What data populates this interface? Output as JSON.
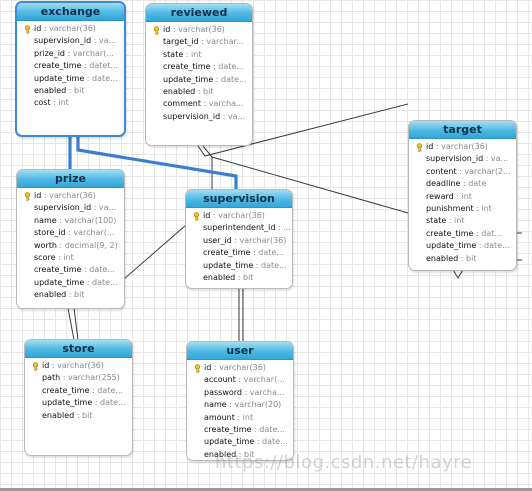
{
  "tables": [
    {
      "key": "exchange",
      "name": "exchange",
      "selected": true,
      "columns": [
        {
          "name": "id",
          "type": "varchar(36)",
          "pk": true
        },
        {
          "name": "supervision_id",
          "type": "va..."
        },
        {
          "name": "prize_id",
          "type": "varchar(..."
        },
        {
          "name": "create_time",
          "type": "datet..."
        },
        {
          "name": "update_time",
          "type": "date..."
        },
        {
          "name": "enabled",
          "type": "bit"
        },
        {
          "name": "cost",
          "type": "int"
        }
      ]
    },
    {
      "key": "reviewed",
      "name": "reviewed",
      "selected": false,
      "columns": [
        {
          "name": "id",
          "type": "varchar(36)",
          "pk": true
        },
        {
          "name": "target_id",
          "type": "varchar..."
        },
        {
          "name": "state",
          "type": "int"
        },
        {
          "name": "create_time",
          "type": "date..."
        },
        {
          "name": "update_time",
          "type": "date..."
        },
        {
          "name": "enabled",
          "type": "bit"
        },
        {
          "name": "comment",
          "type": "varcha..."
        },
        {
          "name": "supervision_id",
          "type": "va..."
        }
      ]
    },
    {
      "key": "prize",
      "name": "prize",
      "selected": false,
      "columns": [
        {
          "name": "id",
          "type": "varchar(36)",
          "pk": true
        },
        {
          "name": "supervision_id",
          "type": "va..."
        },
        {
          "name": "name",
          "type": "varchar(100)"
        },
        {
          "name": "store_id",
          "type": "varchar(..."
        },
        {
          "name": "worth",
          "type": "decimal(9, 2)"
        },
        {
          "name": "score",
          "type": "int"
        },
        {
          "name": "create_time",
          "type": "date..."
        },
        {
          "name": "update_time",
          "type": "date..."
        },
        {
          "name": "enabled",
          "type": "bit"
        }
      ]
    },
    {
      "key": "supervision",
      "name": "supervision",
      "selected": false,
      "columns": [
        {
          "name": "id",
          "type": "varchar(36)",
          "pk": true
        },
        {
          "name": "superintendent_id",
          "type": "..."
        },
        {
          "name": "user_id",
          "type": "varchar(36)"
        },
        {
          "name": "create_time",
          "type": "date..."
        },
        {
          "name": "update_time",
          "type": "date..."
        },
        {
          "name": "enabled",
          "type": "bit"
        }
      ]
    },
    {
      "key": "target",
      "name": "target",
      "selected": false,
      "columns": [
        {
          "name": "id",
          "type": "varchar(36)",
          "pk": true
        },
        {
          "name": "supervision_id",
          "type": "va..."
        },
        {
          "name": "content",
          "type": "varchar(2..."
        },
        {
          "name": "deadline",
          "type": "date"
        },
        {
          "name": "reward",
          "type": "int"
        },
        {
          "name": "punishment",
          "type": "int"
        },
        {
          "name": "state",
          "type": "int"
        },
        {
          "name": "create_time",
          "type": "dat..."
        },
        {
          "name": "update_time",
          "type": "date..."
        },
        {
          "name": "enabled",
          "type": "bit"
        }
      ]
    },
    {
      "key": "store",
      "name": "store",
      "selected": false,
      "columns": [
        {
          "name": "id",
          "type": "varchar(36)",
          "pk": true
        },
        {
          "name": "path",
          "type": "varchar(255)"
        },
        {
          "name": "create_time",
          "type": "date..."
        },
        {
          "name": "update_time",
          "type": "date..."
        },
        {
          "name": "enabled",
          "type": "bit"
        }
      ]
    },
    {
      "key": "user",
      "name": "user",
      "selected": false,
      "columns": [
        {
          "name": "id",
          "type": "varchar(36)",
          "pk": true
        },
        {
          "name": "account",
          "type": "varchar(..."
        },
        {
          "name": "password",
          "type": "varcha..."
        },
        {
          "name": "name",
          "type": "varchar(20)"
        },
        {
          "name": "amount",
          "type": "int"
        },
        {
          "name": "create_time",
          "type": "date..."
        },
        {
          "name": "update_time",
          "type": "date..."
        },
        {
          "name": "enabled",
          "type": "bit"
        }
      ]
    }
  ],
  "relationships": [
    {
      "from": "exchange",
      "to": "supervision",
      "selected": true
    },
    {
      "from": "exchange",
      "to": "prize",
      "selected": true
    },
    {
      "from": "prize",
      "to": "supervision",
      "selected": false
    },
    {
      "from": "prize",
      "to": "store",
      "selected": false
    },
    {
      "from": "supervision",
      "to": "user",
      "selected": false
    },
    {
      "from": "reviewed",
      "to": "target",
      "selected": false
    },
    {
      "from": "reviewed",
      "to": "supervision",
      "selected": false
    },
    {
      "from": "target",
      "to": "supervision",
      "selected": false
    }
  ],
  "watermark": "https://blog.csdn.net/hayre",
  "colors": {
    "header": "#4eb8e3",
    "selected_border": "#3a8ad6",
    "key_icon": "#f2c22a",
    "type_text": "#8a8a8a"
  }
}
